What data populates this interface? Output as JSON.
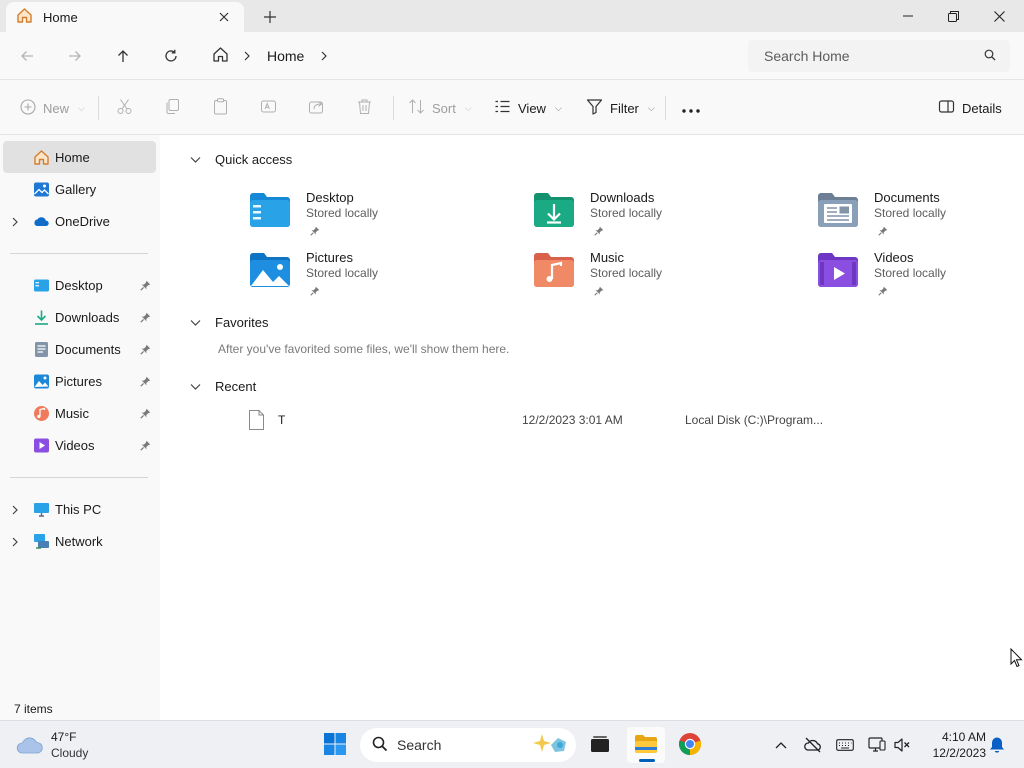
{
  "window": {
    "tab_title": "Home",
    "tab_icon": "home-icon"
  },
  "address": {
    "crumb_home": "Home",
    "search_placeholder": "Search Home"
  },
  "commands": {
    "new": "New",
    "sort": "Sort",
    "view": "View",
    "filter": "Filter",
    "details": "Details"
  },
  "sidebar": {
    "home": "Home",
    "gallery": "Gallery",
    "onedrive": "OneDrive",
    "pinned": [
      {
        "label": "Desktop",
        "icon": "desktop-folder-icon"
      },
      {
        "label": "Downloads",
        "icon": "downloads-folder-icon"
      },
      {
        "label": "Documents",
        "icon": "documents-folder-icon"
      },
      {
        "label": "Pictures",
        "icon": "pictures-folder-icon"
      },
      {
        "label": "Music",
        "icon": "music-folder-icon"
      },
      {
        "label": "Videos",
        "icon": "videos-folder-icon"
      }
    ],
    "this_pc": "This PC",
    "network": "Network"
  },
  "status": {
    "item_count": "7 items"
  },
  "quick_access": {
    "header": "Quick access",
    "folders": [
      {
        "name": "Desktop",
        "sub": "Stored locally",
        "icon": "desktop-folder-icon"
      },
      {
        "name": "Downloads",
        "sub": "Stored locally",
        "icon": "downloads-folder-icon"
      },
      {
        "name": "Documents",
        "sub": "Stored locally",
        "icon": "documents-folder-icon"
      },
      {
        "name": "Pictures",
        "sub": "Stored locally",
        "icon": "pictures-folder-icon"
      },
      {
        "name": "Music",
        "sub": "Stored locally",
        "icon": "music-folder-icon"
      },
      {
        "name": "Videos",
        "sub": "Stored locally",
        "icon": "videos-folder-icon"
      }
    ]
  },
  "favorites": {
    "header": "Favorites",
    "empty_message": "After you've favorited some files, we'll show them here."
  },
  "recent": {
    "header": "Recent",
    "items": [
      {
        "name": "T",
        "date": "12/2/2023 3:01 AM",
        "location": "Local Disk (C:)\\Program..."
      }
    ]
  },
  "taskbar": {
    "weather_temp": "47°F",
    "weather_condition": "Cloudy",
    "search_placeholder": "Search",
    "time": "4:10 AM",
    "date": "12/2/2023"
  },
  "colors": {
    "accent": "#005fb8",
    "folder_blue": "#2aa2e8",
    "downloads_green": "#1bab84",
    "documents_gray": "#8294a8",
    "music_orange": "#f07a5c",
    "videos_purple": "#8a4fe0"
  }
}
